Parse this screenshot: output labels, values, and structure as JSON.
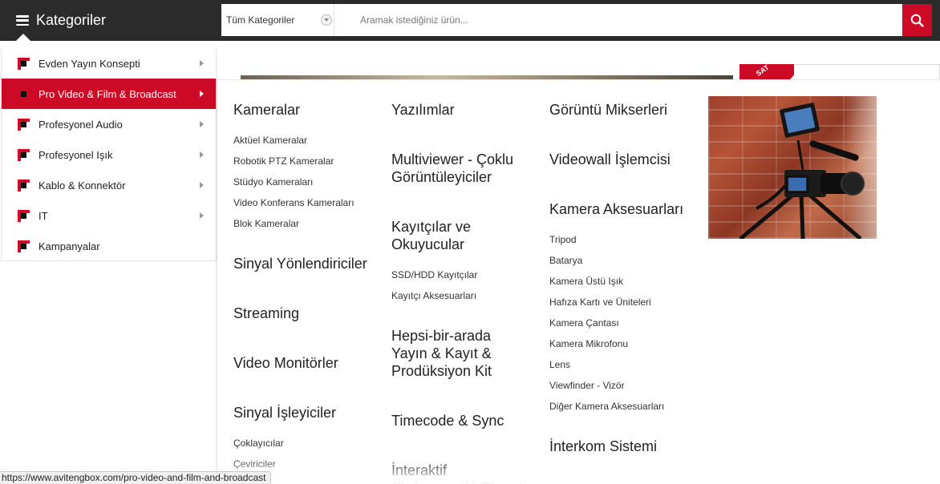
{
  "header": {
    "categories_label": "Kategoriler",
    "search": {
      "category_value": "Tüm Kategoriler",
      "placeholder": "Aramak istediğiniz ürün..."
    }
  },
  "colors": {
    "brand_red": "#cc0a25",
    "topbar": "#2b2b2b"
  },
  "sidebar": {
    "items": [
      {
        "label": "Evden Yayın Konsepti",
        "active": false,
        "has_arrow": true
      },
      {
        "label": "Pro Video & Film & Broadcast",
        "active": true,
        "has_arrow": true
      },
      {
        "label": "Profesyonel Audio",
        "active": false,
        "has_arrow": true
      },
      {
        "label": "Profesyonel Işık",
        "active": false,
        "has_arrow": true
      },
      {
        "label": "Kablo & Konnektör",
        "active": false,
        "has_arrow": true
      },
      {
        "label": "IT",
        "active": false,
        "has_arrow": true
      },
      {
        "label": "Kampanyalar",
        "active": false,
        "has_arrow": false
      }
    ]
  },
  "background": {
    "ribbon_text": "SAT"
  },
  "mega": {
    "col1": {
      "kameralar": "Kameralar",
      "kameralar_items": [
        "Aktüel Kameralar",
        "Robotik PTZ Kameralar",
        "Stüdyo Kameraları",
        "Video Konferans Kameraları",
        "Blok Kameralar"
      ],
      "sinyal_yon": "Sinyal Yönlendiriciler",
      "streaming": "Streaming",
      "video_monitor": "Video Monitörler",
      "sinyal_isl": "Sinyal İşleyiciler",
      "sinyal_isl_items": [
        "Çoklayıcılar",
        "Çeviriciler"
      ]
    },
    "col2": {
      "yazilimlar": "Yazılımlar",
      "multiviewer": "Multiviewer - Çoklu Görüntüleyiciler",
      "kayitcilar": "Kayıtçılar ve Okuyucular",
      "kayitcilar_items": [
        "SSD/HDD Kayıtçılar",
        "Kayıtçı Aksesuarları"
      ],
      "hepsi": "Hepsi-bir-arada Yayın & Kayıt & Prodüksiyon Kit",
      "timecode": "Timecode & Sync",
      "interaktif": "İnteraktif (Dokunmatik) Ekranlar"
    },
    "col3": {
      "mikser": "Görüntü Mikserleri",
      "videowall": "Videowall İşlemcisi",
      "kamera_aks": "Kamera Aksesuarları",
      "kamera_aks_items": [
        "Tripod",
        "Batarya",
        "Kamera Üstü Işık",
        "Hafıza Kartı ve Üniteleri",
        "Kamera Çantası",
        "Kamera Mikrofonu",
        "Lens",
        "Viewfinder - Vizör",
        "Diğer Kamera Aksesuarları"
      ],
      "interkom": "İnterkom Sistemi"
    }
  },
  "status_url": "https://www.avitengbox.com/pro-video-and-film-and-broadcast"
}
